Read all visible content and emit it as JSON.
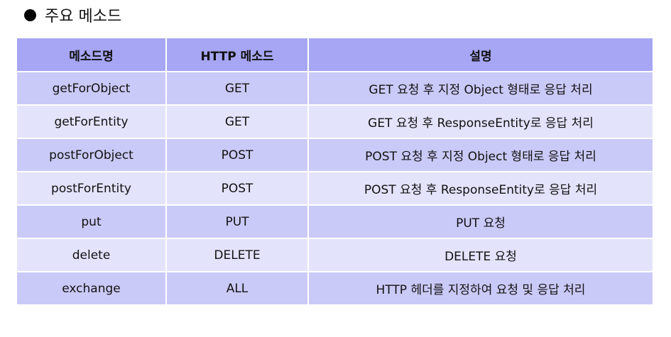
{
  "heading": {
    "bullet_icon": "filled-circle-icon",
    "title": "주요 메소드"
  },
  "table": {
    "header_color": "#a6a6f4",
    "odd_row_color": "#cacaf8",
    "even_row_color": "#e3e3fc",
    "columns": [
      "메소드명",
      "HTTP 메소드",
      "설명"
    ],
    "rows": [
      {
        "method": "getForObject",
        "http": "GET",
        "desc": "GET 요청 후 지정 Object 형태로 응답 처리"
      },
      {
        "method": "getForEntity",
        "http": "GET",
        "desc": "GET 요청 후 ResponseEntity로 응답 처리"
      },
      {
        "method": "postForObject",
        "http": "POST",
        "desc": "POST 요청 후 지정 Object 형태로 응답 처리"
      },
      {
        "method": "postForEntity",
        "http": "POST",
        "desc": "POST 요청 후 ResponseEntity로 응답 처리"
      },
      {
        "method": "put",
        "http": "PUT",
        "desc": "PUT 요청"
      },
      {
        "method": "delete",
        "http": "DELETE",
        "desc": "DELETE 요청"
      },
      {
        "method": "exchange",
        "http": "ALL",
        "desc": "HTTP 헤더를 지정하여 요청 및 응답 처리"
      }
    ]
  }
}
